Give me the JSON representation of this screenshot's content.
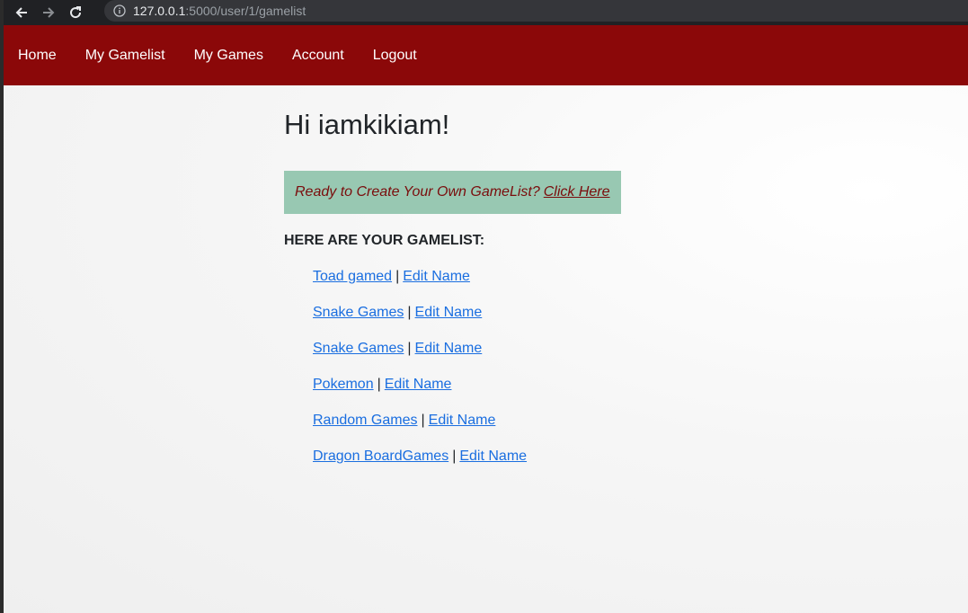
{
  "browser": {
    "url_host": "127.0.0.1",
    "url_path": ":5000/user/1/gamelist"
  },
  "navbar": {
    "items": [
      {
        "label": "Home"
      },
      {
        "label": "My Gamelist"
      },
      {
        "label": "My Games"
      },
      {
        "label": "Account"
      },
      {
        "label": "Logout"
      }
    ]
  },
  "main": {
    "greeting": "Hi iamkikiam!",
    "callout_text": "Ready to Create Your Own GameList?",
    "callout_link": "Click Here",
    "list_heading": "HERE ARE YOUR GAMELIST:",
    "separator": "|",
    "gamelists": [
      {
        "name": "Toad gamed",
        "edit": "Edit Name"
      },
      {
        "name": "Snake Games",
        "edit": "Edit Name"
      },
      {
        "name": "Snake Games",
        "edit": "Edit Name"
      },
      {
        "name": "Pokemon",
        "edit": "Edit Name"
      },
      {
        "name": "Random Games",
        "edit": "Edit Name"
      },
      {
        "name": "Dragon BoardGames",
        "edit": "Edit Name"
      }
    ]
  },
  "colors": {
    "navbar": "#8b0809",
    "callout_bg": "#98c8b2",
    "link": "#1a6ee0"
  }
}
